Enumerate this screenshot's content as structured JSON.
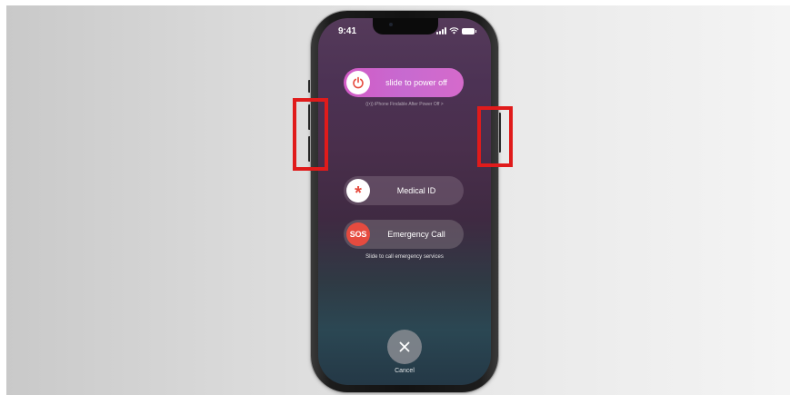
{
  "status_bar": {
    "time": "9:41",
    "icons": [
      "signal-icon",
      "wifi-icon",
      "battery-icon"
    ]
  },
  "power_slider": {
    "label": "slide to power off",
    "icon": "power-icon",
    "color": "#d25bc6"
  },
  "findable": {
    "text": "((•)) iPhone Findable After Power Off >"
  },
  "medical_id": {
    "label": "Medical ID",
    "icon": "asterisk-icon",
    "icon_color": "#e64b3f"
  },
  "emergency_call": {
    "label": "Emergency Call",
    "knob_text": "SOS",
    "knob_color": "#e64b3f"
  },
  "emergency_hint": "Slide to call emergency services",
  "cancel": {
    "label": "Cancel",
    "icon": "close-icon"
  },
  "highlight_color": "#e01b1b"
}
